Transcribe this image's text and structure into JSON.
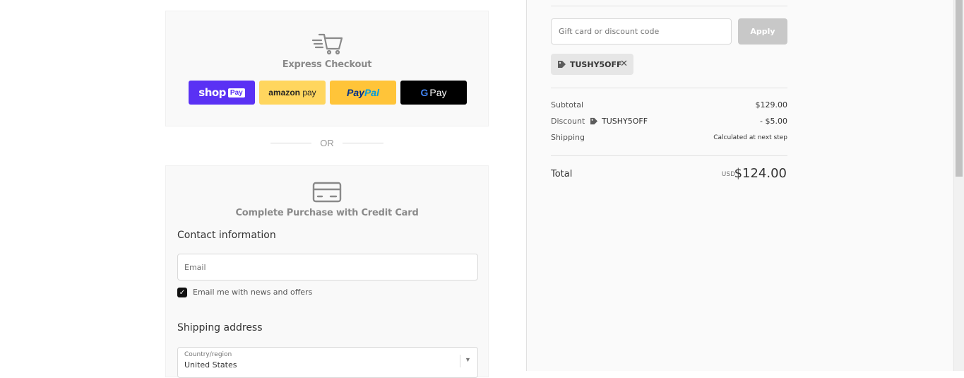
{
  "express": {
    "title": "Express Checkout",
    "shop_pay": {
      "brand": "shop",
      "chip": "Pay"
    },
    "amazon_pay": {
      "brand": "amazon",
      "suffix": "pay"
    },
    "paypal": {
      "part1": "Pay",
      "part2": "Pal"
    },
    "google_pay": {
      "g": "G",
      "suffix": "Pay"
    }
  },
  "or_text": "OR",
  "credit_card": {
    "title": "Complete Purchase with Credit Card",
    "contact_heading": "Contact information",
    "email_placeholder": "Email",
    "newsletter_label": "Email me with news and offers",
    "newsletter_checked": true,
    "shipping_heading": "Shipping address",
    "country_label": "Country/region",
    "country_value": "United States"
  },
  "summary": {
    "discount_placeholder": "Gift card or discount code",
    "apply_label": "Apply",
    "applied_code": "TUSHY5OFF",
    "subtotal_label": "Subtotal",
    "subtotal_value": "$129.00",
    "discount_label": "Discount",
    "discount_code": "TUSHY5OFF",
    "discount_value": "- $5.00",
    "shipping_label": "Shipping",
    "shipping_value": "Calculated at next step",
    "total_label": "Total",
    "total_currency": "USD",
    "total_value": "$124.00"
  },
  "colors": {
    "shop_pay": "#5a31f4",
    "amazon_pay": "#ffd65e",
    "paypal": "#ffc439",
    "google_pay": "#000000",
    "apply_disabled": "#c8c8c8"
  }
}
